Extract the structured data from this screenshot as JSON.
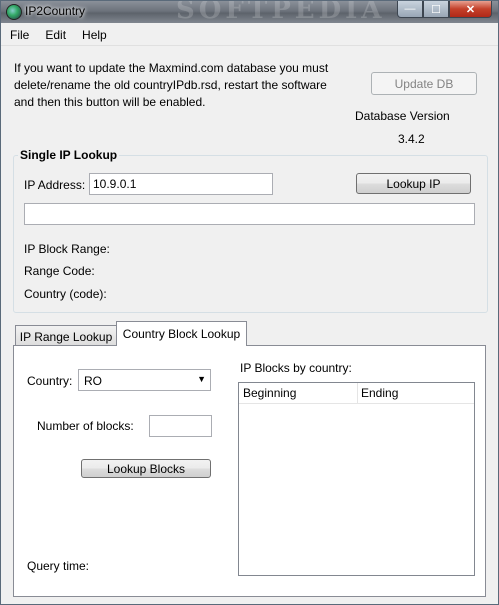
{
  "window": {
    "title": "IP2Country",
    "watermark": "SOFTPEDIA",
    "controls": {
      "minimize": "—",
      "maximize": "☐",
      "close": "✕"
    }
  },
  "menu": [
    "File",
    "Edit",
    "Help"
  ],
  "update": {
    "info_lines": [
      "If you want to update the Maxmind.com database you must",
      "delete/rename the old countryIPdb.rsd, restart the software",
      "and then this button will be enabled."
    ],
    "button_label": "Update DB",
    "db_version_label": "Database Version",
    "db_version_value": "3.4.2"
  },
  "single_lookup": {
    "title": "Single IP Lookup",
    "ip_label": "IP Address:",
    "ip_value": "10.9.0.1",
    "lookup_button": "Lookup IP",
    "result_value": "",
    "block_range_label": "IP Block Range:",
    "range_code_label": "Range Code:",
    "country_code_label": "Country  (code):"
  },
  "tabs": [
    {
      "label": "IP Range Lookup",
      "active": false
    },
    {
      "label": "Country Block Lookup",
      "active": true
    }
  ],
  "country_block": {
    "country_label": "Country:",
    "country_value": "RO",
    "blocks_label": "Number of blocks:",
    "blocks_value": "",
    "lookup_button": "Lookup Blocks",
    "query_time_label": "Query time:",
    "list_title": "IP Blocks by country:",
    "columns": [
      "Beginning",
      "Ending"
    ],
    "rows": []
  },
  "icons": {
    "app": "globe-icon",
    "dropdown": "chevron-down-icon"
  }
}
